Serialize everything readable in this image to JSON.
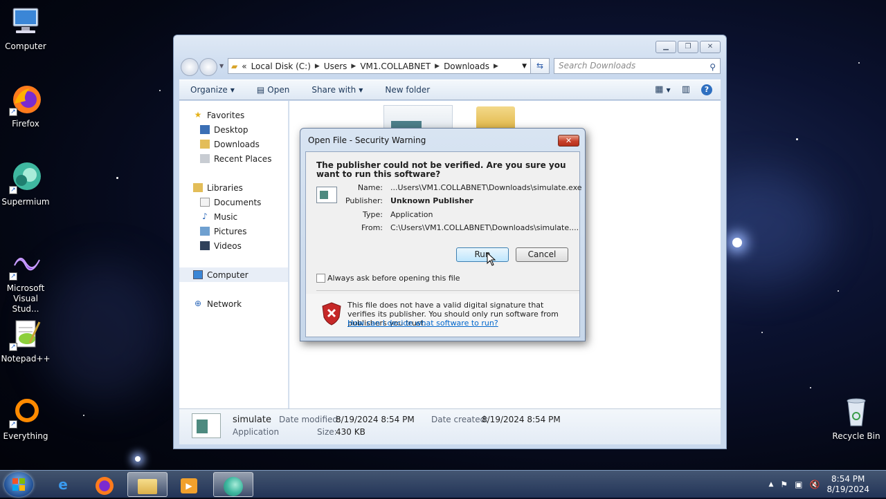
{
  "desktop": {
    "icons": [
      {
        "label": "Computer"
      },
      {
        "label": "Firefox"
      },
      {
        "label": "Supermium"
      },
      {
        "label": "Microsoft Visual Stud..."
      },
      {
        "label": "Notepad++"
      },
      {
        "label": "Everything"
      },
      {
        "label": "Recycle Bin"
      }
    ]
  },
  "explorer": {
    "address": {
      "prefix": "«",
      "crumbs": [
        "Local Disk (C:)",
        "Users",
        "VM1.COLLABNET",
        "Downloads"
      ]
    },
    "search": {
      "placeholder": "Search Downloads"
    },
    "toolbar": {
      "organize": "Organize",
      "open": "Open",
      "share_with": "Share with",
      "new_folder": "New folder"
    },
    "nav": {
      "favorites": "Favorites",
      "desktop": "Desktop",
      "downloads": "Downloads",
      "recent_places": "Recent Places",
      "libraries": "Libraries",
      "documents": "Documents",
      "music": "Music",
      "pictures": "Pictures",
      "videos": "Videos",
      "computer": "Computer",
      "network": "Network"
    },
    "details": {
      "name": "simulate",
      "type": "Application",
      "date_modified_label": "Date modified:",
      "date_modified": "8/19/2024 8:54 PM",
      "date_created_label": "Date created:",
      "date_created": "8/19/2024 8:54 PM",
      "size_label": "Size:",
      "size": "430 KB"
    }
  },
  "dialog": {
    "title": "Open File - Security Warning",
    "question": "The publisher could not be verified.  Are you sure you want to run this software?",
    "fields": {
      "name_label": "Name:",
      "name": "...Users\\VM1.COLLABNET\\Downloads\\simulate.exe",
      "publisher_label": "Publisher:",
      "publisher": "Unknown Publisher",
      "type_label": "Type:",
      "type": "Application",
      "from_label": "From:",
      "from": "C:\\Users\\VM1.COLLABNET\\Downloads\\simulate...."
    },
    "run_label": "Run",
    "cancel_label": "Cancel",
    "checkbox_label": "Always ask before opening this file",
    "checkbox_checked": false,
    "warning_text": "This file does not have a valid digital signature that verifies its publisher.  You should only run software from publishers you trust.",
    "help_link": "How can I decide what software to run?"
  },
  "taskbar": {
    "clock_time": "8:54 PM",
    "clock_date": "8/19/2024"
  }
}
